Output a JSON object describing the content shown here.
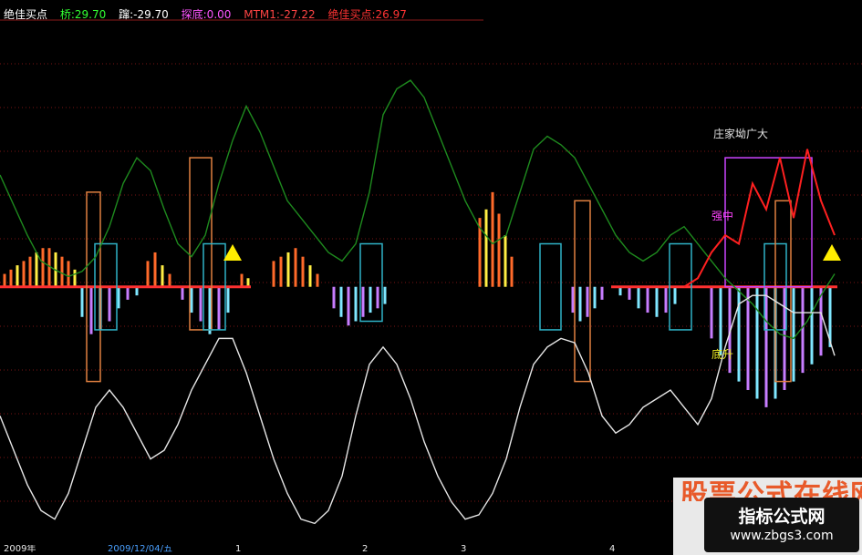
{
  "header": {
    "indicator_name": "绝佳买点",
    "items": [
      {
        "text": "桥:29.70",
        "color": "#33ff33"
      },
      {
        "text": "蹿:-29.70",
        "color": "#ffffff"
      },
      {
        "text": "探底:0.00",
        "color": "#ff55ff"
      },
      {
        "text": "MTM1:-27.22",
        "color": "#ff4444"
      },
      {
        "text": "绝佳买点:26.97",
        "color": "#ff3333"
      }
    ]
  },
  "annotations": {
    "main_force": "庄家坳广大",
    "strong": "强中",
    "bottom_rise": "底升"
  },
  "date_axis": [
    "2009年",
    "2009/12/04/五",
    "1",
    "2",
    "3",
    "4"
  ],
  "watermark": {
    "title": "股票公式在线网",
    "plate_title": "指标公式网",
    "url": "www.zbgs3.com"
  },
  "chart_data": {
    "type": "line",
    "title": "",
    "xlabel": "",
    "ylabel": "",
    "x": [
      0,
      15,
      30,
      45,
      60,
      75,
      90,
      105,
      120,
      135,
      150,
      165,
      180,
      195,
      210,
      225,
      240,
      255,
      270,
      285,
      300,
      315,
      330,
      345,
      360,
      375,
      390,
      405,
      420,
      435,
      450,
      465,
      480,
      495,
      510,
      525,
      540,
      555,
      570,
      585,
      600,
      615,
      630,
      645,
      660,
      675,
      690,
      705,
      720,
      735,
      750,
      765,
      780,
      795,
      810,
      825,
      840,
      855,
      870,
      885,
      900,
      915
    ],
    "series": [
      {
        "name": "green",
        "color": "#1e8a1e",
        "values": [
          130,
          95,
          60,
          30,
          20,
          12,
          18,
          35,
          70,
          120,
          150,
          135,
          90,
          50,
          35,
          60,
          120,
          170,
          210,
          180,
          140,
          100,
          80,
          60,
          40,
          30,
          50,
          110,
          200,
          230,
          240,
          220,
          180,
          140,
          100,
          70,
          50,
          60,
          110,
          160,
          175,
          165,
          150,
          120,
          90,
          60,
          40,
          30,
          40,
          60,
          70,
          50,
          30,
          10,
          -5,
          -20,
          -40,
          -55,
          -60,
          -40,
          -10,
          15
        ]
      },
      {
        "name": "white",
        "color": "#e6e6e6",
        "values": [
          -150,
          -190,
          -230,
          -260,
          -270,
          -240,
          -190,
          -140,
          -120,
          -140,
          -170,
          -200,
          -190,
          -160,
          -120,
          -90,
          -60,
          -60,
          -100,
          -150,
          -200,
          -240,
          -270,
          -275,
          -260,
          -220,
          -150,
          -90,
          -70,
          -90,
          -130,
          -180,
          -220,
          -250,
          -270,
          -265,
          -240,
          -200,
          -140,
          -90,
          -70,
          -60,
          -65,
          -100,
          -150,
          -170,
          -160,
          -140,
          -130,
          -120,
          -140,
          -160,
          -130,
          -70,
          -20,
          -10,
          -10,
          -20,
          -30,
          -30,
          -30,
          -80
        ]
      },
      {
        "name": "red",
        "color": "#ff2020",
        "values": [
          0,
          0,
          0,
          0,
          0,
          0,
          0,
          0,
          0,
          0,
          0,
          0,
          0,
          0,
          0,
          0,
          0,
          0,
          0,
          0,
          0,
          0,
          0,
          0,
          0,
          0,
          0,
          0,
          0,
          0,
          0,
          0,
          0,
          0,
          0,
          0,
          0,
          0,
          0,
          0,
          0,
          0,
          0,
          0,
          0,
          0,
          0,
          0,
          0,
          0,
          0,
          10,
          40,
          60,
          50,
          120,
          90,
          150,
          80,
          160,
          100,
          60
        ]
      }
    ],
    "bars_up": {
      "x": [
        5,
        12,
        19,
        26,
        33,
        40,
        47,
        54,
        61,
        68,
        75,
        82,
        162,
        170,
        178,
        186,
        265,
        272,
        300,
        308,
        316,
        324,
        332,
        340,
        348,
        526,
        533,
        540,
        547,
        554,
        561
      ],
      "values": [
        15,
        20,
        25,
        30,
        35,
        40,
        45,
        45,
        40,
        35,
        30,
        20,
        30,
        40,
        25,
        15,
        15,
        10,
        30,
        35,
        40,
        45,
        35,
        25,
        15,
        80,
        90,
        110,
        85,
        60,
        35
      ]
    },
    "bars_down": {
      "x": [
        90,
        100,
        110,
        120,
        130,
        140,
        150,
        200,
        210,
        220,
        230,
        240,
        250,
        366,
        374,
        382,
        390,
        398,
        406,
        414,
        422,
        628,
        636,
        644,
        652,
        660,
        680,
        690,
        700,
        710,
        720,
        730,
        740,
        780,
        790,
        800,
        810,
        820,
        830,
        840,
        850,
        860,
        870,
        880,
        890,
        900,
        910
      ],
      "values": [
        35,
        55,
        50,
        40,
        25,
        15,
        10,
        15,
        30,
        40,
        55,
        50,
        30,
        25,
        35,
        45,
        40,
        35,
        30,
        25,
        20,
        30,
        40,
        35,
        25,
        15,
        10,
        15,
        25,
        30,
        35,
        30,
        20,
        60,
        80,
        100,
        110,
        120,
        130,
        140,
        130,
        120,
        110,
        100,
        90,
        80,
        70
      ]
    },
    "boxes": [
      {
        "x0": 95,
        "x1": 110,
        "hi": 110,
        "lo": -110
      },
      {
        "x0": 104,
        "x1": 128,
        "hi": 50,
        "lo": -50
      },
      {
        "x0": 208,
        "x1": 232,
        "hi": 150,
        "lo": -50
      },
      {
        "x0": 223,
        "x1": 247,
        "hi": 50,
        "lo": -50
      },
      {
        "x0": 395,
        "x1": 419,
        "hi": 50,
        "lo": -40
      },
      {
        "x0": 592,
        "x1": 615,
        "hi": 50,
        "lo": -50
      },
      {
        "x0": 630,
        "x1": 647,
        "hi": 100,
        "lo": -110
      },
      {
        "x0": 734,
        "x1": 758,
        "hi": 50,
        "lo": -50
      },
      {
        "x0": 838,
        "x1": 862,
        "hi": 50,
        "lo": -50
      },
      {
        "x0": 850,
        "x1": 867,
        "hi": 100,
        "lo": -110
      },
      {
        "x0": 795,
        "x1": 890,
        "hi": 150,
        "lo": 0
      }
    ],
    "markers": [
      {
        "x": 255,
        "value": 40
      },
      {
        "x": 912,
        "value": 40
      }
    ],
    "grid": true,
    "ylim": [
      -300,
      310
    ]
  }
}
